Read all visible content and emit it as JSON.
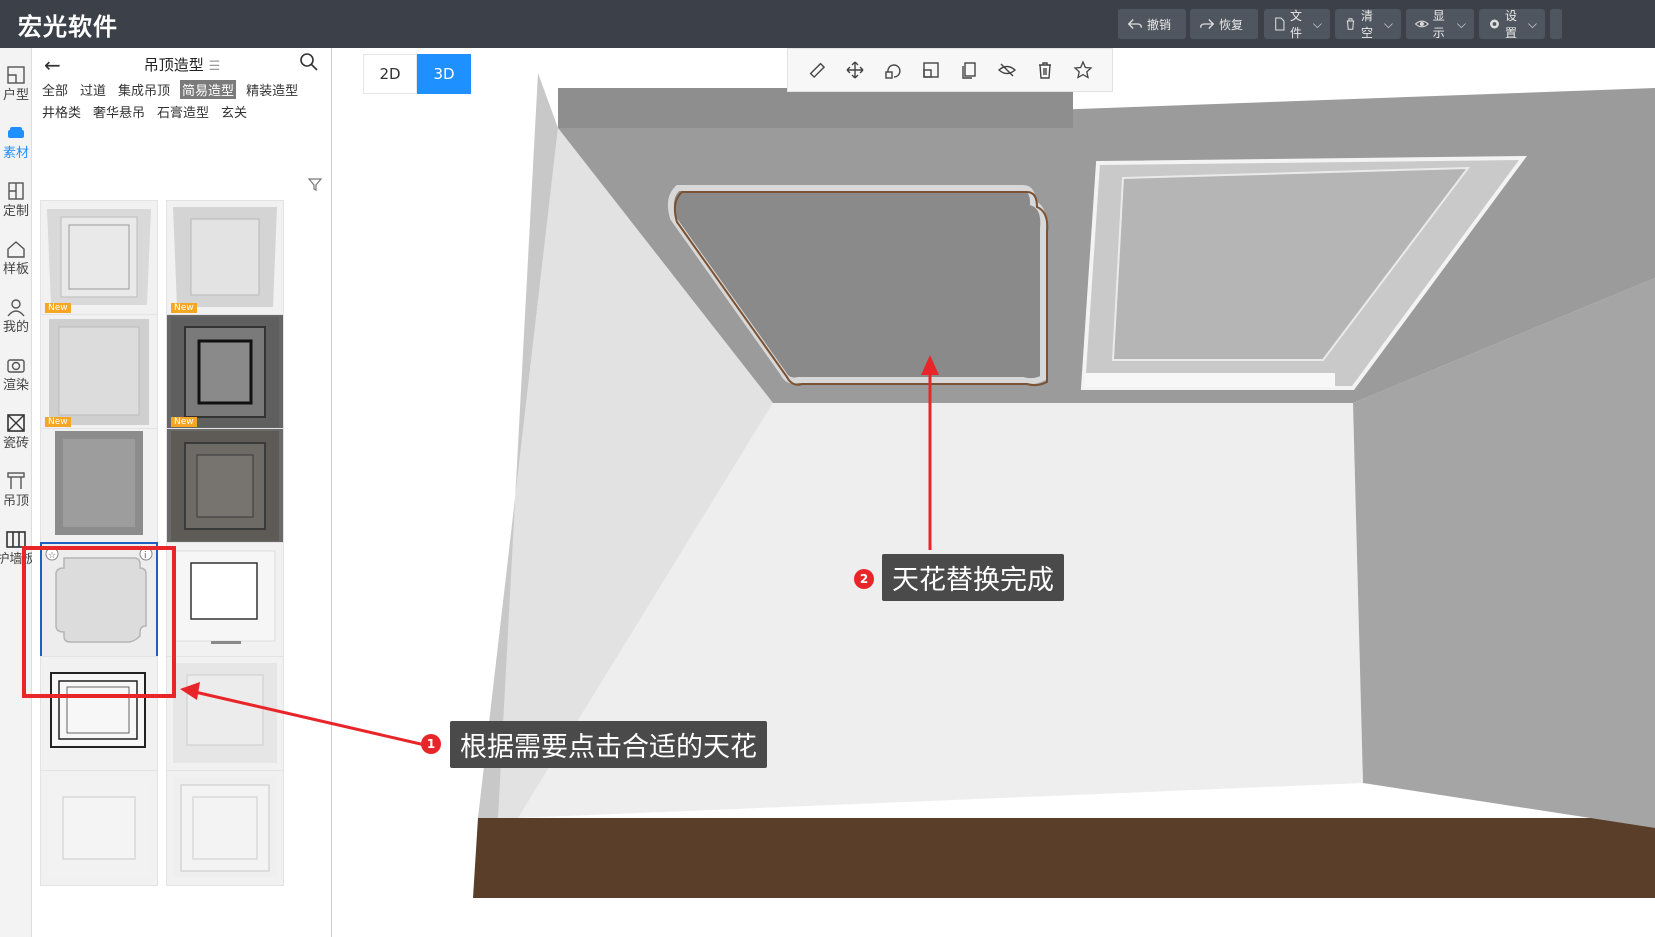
{
  "app": {
    "title": "宏光软件"
  },
  "toolbar": {
    "undo": "撤销",
    "redo": "恢复",
    "file": "文件",
    "clear": "清空",
    "display": "显示",
    "settings": "设置"
  },
  "rail": {
    "items": [
      {
        "label": "户型",
        "icon": "floorplan-icon"
      },
      {
        "label": "素材",
        "icon": "sofa-icon",
        "active": true
      },
      {
        "label": "定制",
        "icon": "cabinet-icon"
      },
      {
        "label": "样板",
        "icon": "house-icon"
      },
      {
        "label": "我的",
        "icon": "user-icon"
      },
      {
        "label": "渲染",
        "icon": "camera-icon"
      },
      {
        "label": "瓷砖",
        "icon": "tile-icon"
      },
      {
        "label": "吊顶",
        "icon": "ceiling-icon"
      },
      {
        "label": "护墙板",
        "icon": "wallpanel-icon"
      }
    ]
  },
  "panel": {
    "title": "吊顶造型",
    "categories_row1": [
      "全部",
      "过道",
      "集成吊顶",
      "简易造型",
      "精装造型"
    ],
    "categories_row2": [
      "井格类",
      "奢华悬吊",
      "石膏造型",
      "玄关"
    ],
    "selected_category": "简易造型",
    "new_badge": "New"
  },
  "viewport": {
    "mode_2d": "2D",
    "mode_3d": "3D",
    "active_mode": "3D"
  },
  "annotations": {
    "step1_number": "1",
    "step1_text": "根据需要点击合适的天花",
    "step2_number": "2",
    "step2_text": "天花替换完成"
  },
  "colors": {
    "topbar": "#3c4149",
    "accent": "#1e90ff",
    "highlight": "#e8262a",
    "new_badge": "#f5a623"
  }
}
